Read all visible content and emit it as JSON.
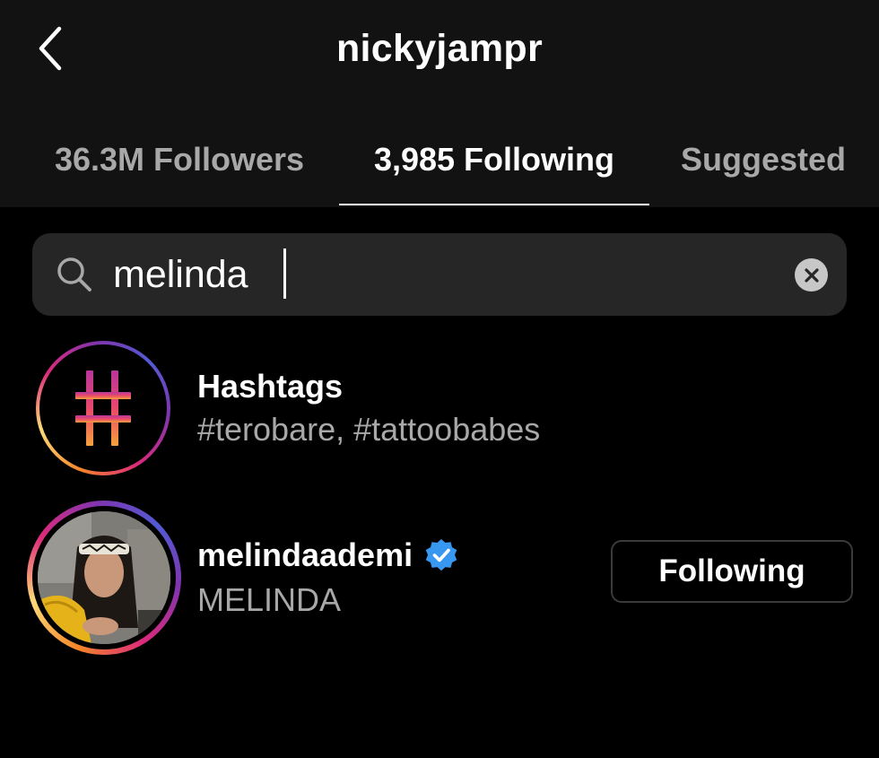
{
  "header": {
    "title": "nickyjampr",
    "back_icon": "chevron-left-icon"
  },
  "tabs": [
    {
      "label": "36.3M Followers",
      "active": false
    },
    {
      "label": "3,985 Following",
      "active": true
    },
    {
      "label": "Suggested",
      "active": false
    }
  ],
  "search": {
    "value": "melinda",
    "placeholder": "Search",
    "icon": "search-icon",
    "clear_icon": "clear-icon"
  },
  "results": {
    "hashtags": {
      "title": "Hashtags",
      "subtitle": "#terobare, #tattoobabes",
      "icon": "hashtag-icon"
    },
    "user": {
      "username": "melindaademi",
      "full_name": "MELINDA",
      "verified": true,
      "button_label": "Following"
    }
  },
  "colors": {
    "background": "#000000",
    "header_background": "#121212",
    "search_background": "#262626",
    "secondary_text": "#a8a8a8",
    "verified_blue": "#3897f0",
    "button_border": "#3a3a3a"
  }
}
